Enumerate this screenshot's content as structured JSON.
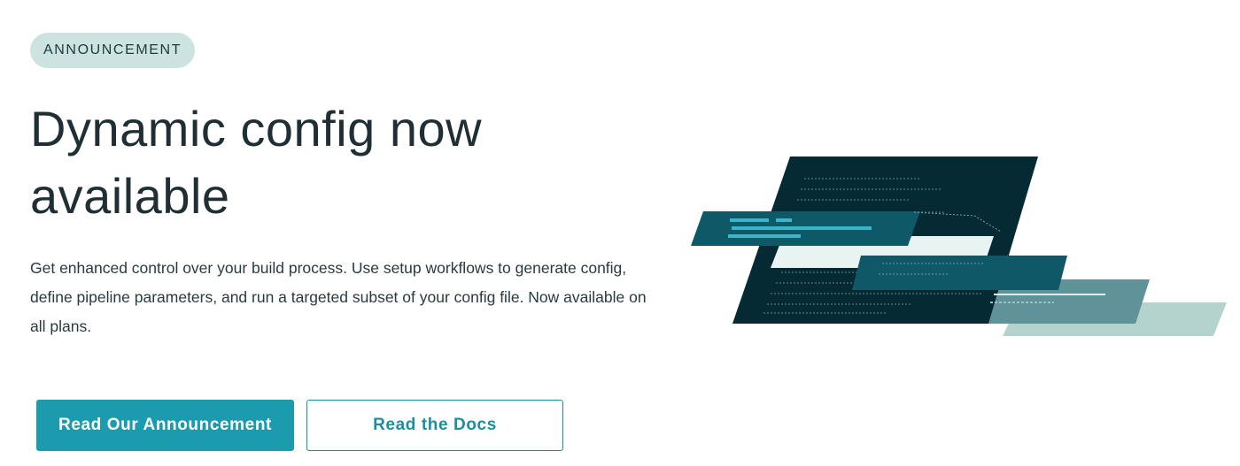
{
  "badge": {
    "label": "ANNOUNCEMENT"
  },
  "hero": {
    "headline_line1": "Dynamic config now",
    "headline_line2": "available",
    "description": "Get enhanced control over your build process. Use setup workflows to generate config, define pipeline parameters, and run a targeted subset of your config file. Now available on all plans."
  },
  "actions": {
    "primary_label": "Read Our Announcement",
    "secondary_label": "Read the Docs"
  },
  "colors": {
    "accent": "#1b9bad",
    "badge_bg": "#cde3df",
    "panel_dark": "#052a33",
    "panel_teal": "#0e5868",
    "panel_mid": "#5f9399",
    "panel_light": "#b5d3cd"
  },
  "illustration": {
    "icon": "config-code-editor-illustration"
  }
}
